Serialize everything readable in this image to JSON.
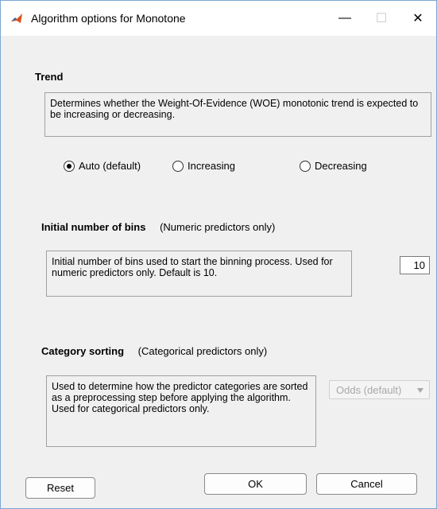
{
  "window": {
    "title": "Algorithm options for Monotone",
    "minimize_glyph": "—",
    "maximize_glyph": "☐",
    "close_glyph": "✕"
  },
  "trend": {
    "heading": "Trend",
    "description": "Determines whether the Weight-Of-Evidence (WOE) monotonic trend is expected to be increasing or decreasing.",
    "options": [
      {
        "label": "Auto (default)",
        "selected": true
      },
      {
        "label": "Increasing",
        "selected": false
      },
      {
        "label": "Decreasing",
        "selected": false
      }
    ]
  },
  "initial_bins": {
    "heading": "Initial number of bins",
    "note": "(Numeric predictors only)",
    "description": "Initial number of bins used to start the binning process.  Used for numeric predictors only. Default is 10.",
    "value": "10"
  },
  "category_sorting": {
    "heading": "Category sorting",
    "note": "(Categorical predictors only)",
    "description": "Used to determine how the predictor categories are sorted as a preprocessing step before applying the algorithm. Used for categorical predictors only.",
    "selected": "Odds (default)",
    "enabled": false
  },
  "buttons": {
    "reset": "Reset",
    "ok": "OK",
    "cancel": "Cancel"
  },
  "icons": {
    "app": "matlab-icon"
  }
}
